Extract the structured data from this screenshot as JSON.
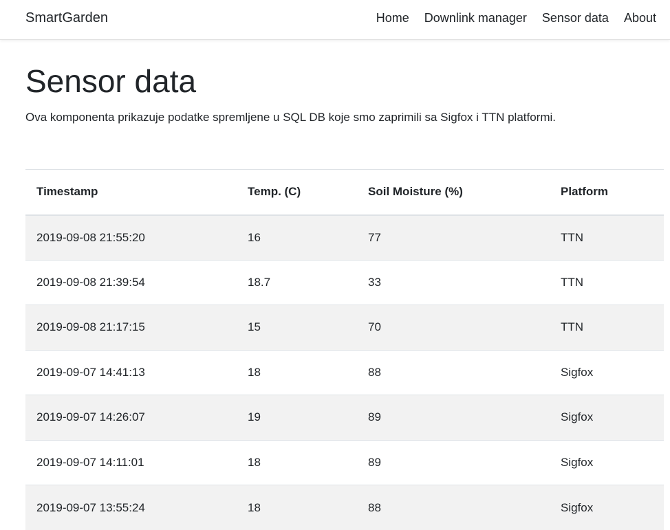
{
  "navbar": {
    "brand": "SmartGarden",
    "links": [
      "Home",
      "Downlink manager",
      "Sensor data",
      "About"
    ]
  },
  "page": {
    "title": "Sensor data",
    "description": "Ova komponenta prikazuje podatke spremljene u SQL DB koje smo zaprimili sa Sigfox i TTN platformi."
  },
  "table": {
    "headers": [
      "Timestamp",
      "Temp. (C)",
      "Soil Moisture (%)",
      "Platform"
    ],
    "rows": [
      [
        "2019-09-08 21:55:20",
        "16",
        "77",
        "TTN"
      ],
      [
        "2019-09-08 21:39:54",
        "18.7",
        "33",
        "TTN"
      ],
      [
        "2019-09-08 21:17:15",
        "15",
        "70",
        "TTN"
      ],
      [
        "2019-09-07 14:41:13",
        "18",
        "88",
        "Sigfox"
      ],
      [
        "2019-09-07 14:26:07",
        "19",
        "89",
        "Sigfox"
      ],
      [
        "2019-09-07 14:11:01",
        "18",
        "89",
        "Sigfox"
      ],
      [
        "2019-09-07 13:55:24",
        "18",
        "88",
        "Sigfox"
      ]
    ]
  },
  "colors": {
    "stripe": "#f2f2f2",
    "border": "#dee2e6",
    "text": "#212529"
  }
}
